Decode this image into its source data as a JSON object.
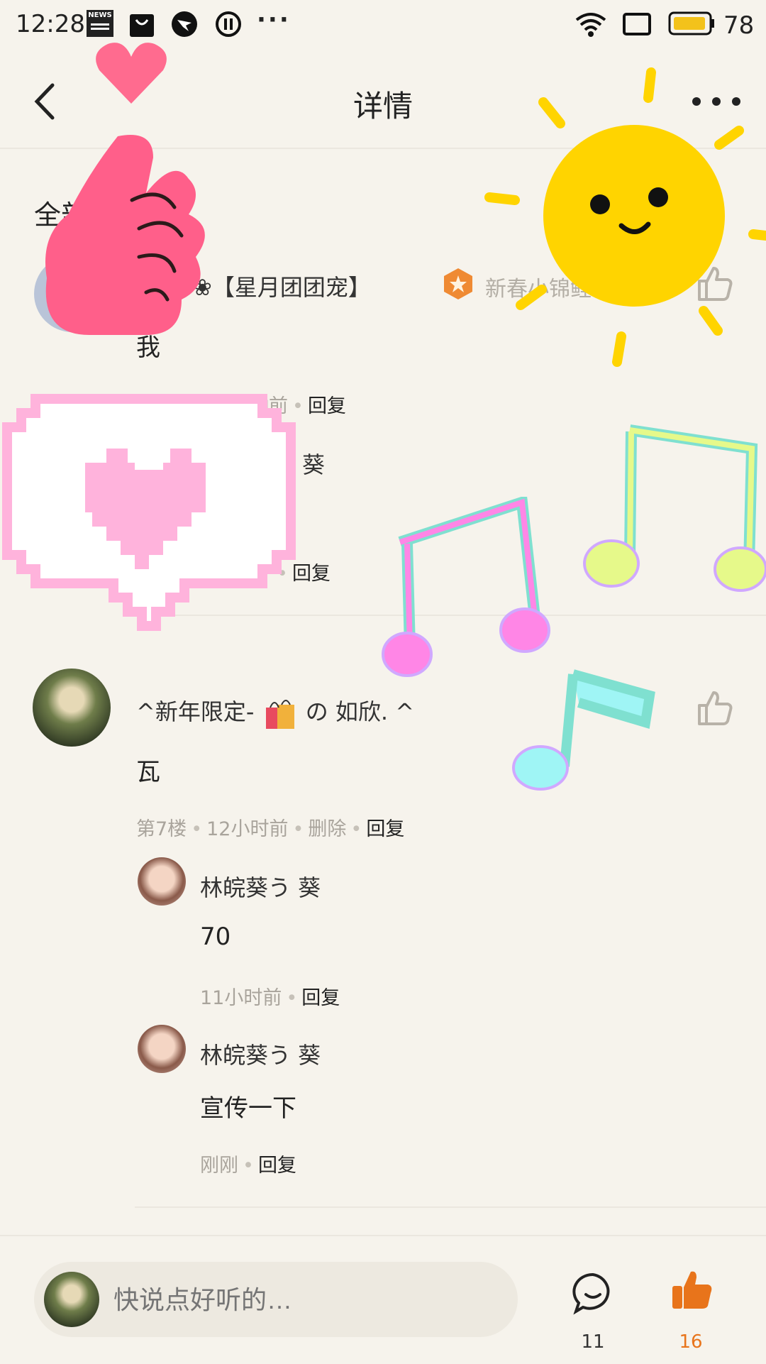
{
  "status_bar": {
    "time": "12:28",
    "news_label": "NEWS",
    "more": "···",
    "battery": "78"
  },
  "header": {
    "title": "详情"
  },
  "section_label": "全部",
  "comments": [
    {
      "name": "❀【星月团团宠】",
      "badge_text": "新春小锦鲤",
      "content": "我",
      "meta": {
        "time": "钟前",
        "reply": "回复"
      },
      "replies": [
        {
          "name": "葵",
          "content": "宣传一下",
          "meta": {
            "reply": "回复"
          }
        }
      ]
    },
    {
      "name_prefix": "^新年限定-",
      "name_suffix": "の 如欣. ^",
      "content": "瓦",
      "meta": {
        "floor": "第7楼",
        "time": "12小时前",
        "delete": "删除",
        "reply": "回复"
      },
      "replies": [
        {
          "name": "林皖葵う 葵",
          "content": "70",
          "meta": {
            "time": "11小时前",
            "reply": "回复"
          }
        },
        {
          "name": "林皖葵う 葵",
          "content": "宣传一下",
          "meta": {
            "time": "刚刚",
            "reply": "回复"
          }
        }
      ]
    }
  ],
  "bottom_bar": {
    "placeholder": "快说点好听的…",
    "comment_count": "11",
    "like_count": "16"
  },
  "colors": {
    "background": "#f6f3ec",
    "like_active": "#e8741b",
    "meta_gray": "#a9a49c"
  },
  "icons": [
    "back-icon",
    "more-icon",
    "thumb-up-icon",
    "comment-bubble-icon",
    "thumb-up-filled-icon"
  ]
}
